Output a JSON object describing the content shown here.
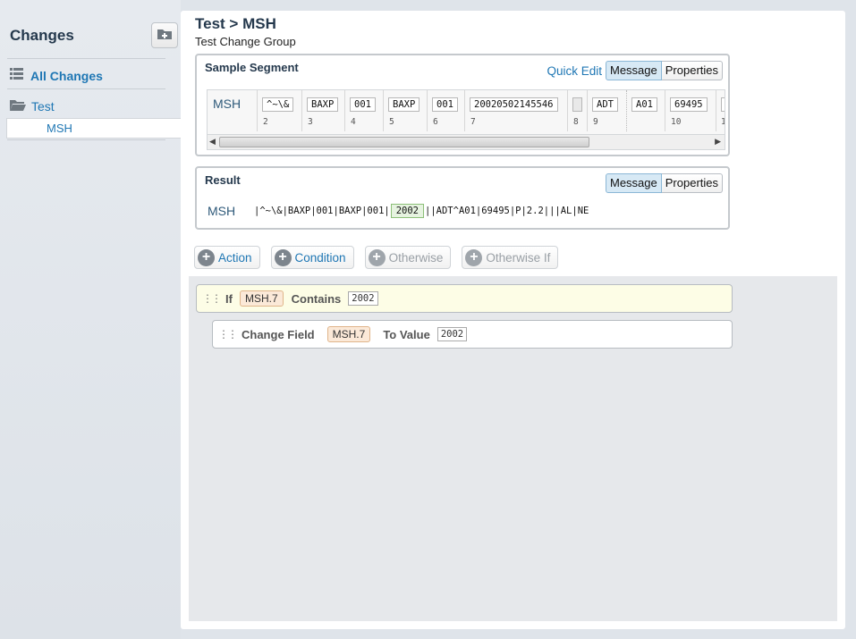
{
  "sidebar": {
    "title": "Changes",
    "add_folder_icon": "folder-plus-icon",
    "all_changes_label": "All Changes",
    "folder_label": "Test",
    "selected_item": "MSH"
  },
  "main": {
    "breadcrumb": "Test > MSH",
    "subtitle": "Test Change Group"
  },
  "sample_segment": {
    "title": "Sample Segment",
    "quick_edit_label": "Quick Edit",
    "message_label": "Message",
    "properties_label": "Properties",
    "segment_name": "MSH",
    "fields": [
      {
        "value": "^~\\&",
        "num": "2"
      },
      {
        "value": "BAXP",
        "num": "3"
      },
      {
        "value": "001",
        "num": "4"
      },
      {
        "value": "BAXP",
        "num": "5"
      },
      {
        "value": "001",
        "num": "6"
      },
      {
        "value": "20020502145546",
        "num": "7"
      },
      {
        "value": "",
        "num": "8"
      },
      {
        "value": "ADT",
        "num": "9"
      },
      {
        "value": "A01",
        "num": ""
      },
      {
        "value": "69495",
        "num": "10"
      },
      {
        "value": "",
        "num": "1"
      }
    ]
  },
  "result": {
    "title": "Result",
    "message_label": "Message",
    "properties_label": "Properties",
    "segment_name": "MSH",
    "line_before": "|^~\\&|BAXP|001|BAXP|001|",
    "highlight": "2002",
    "line_after": "||ADT^A01|69495|P|2.2|||AL|NE"
  },
  "actions": {
    "action_label": "Action",
    "condition_label": "Condition",
    "otherwise_label": "Otherwise",
    "otherwise_if_label": "Otherwise If"
  },
  "rules": {
    "if_keyword": "If",
    "if_field": "MSH.7",
    "if_operator": "Contains",
    "if_value": "2002",
    "change_keyword": "Change Field",
    "change_field": "MSH.7",
    "to_value_keyword": "To Value",
    "change_value": "2002"
  }
}
